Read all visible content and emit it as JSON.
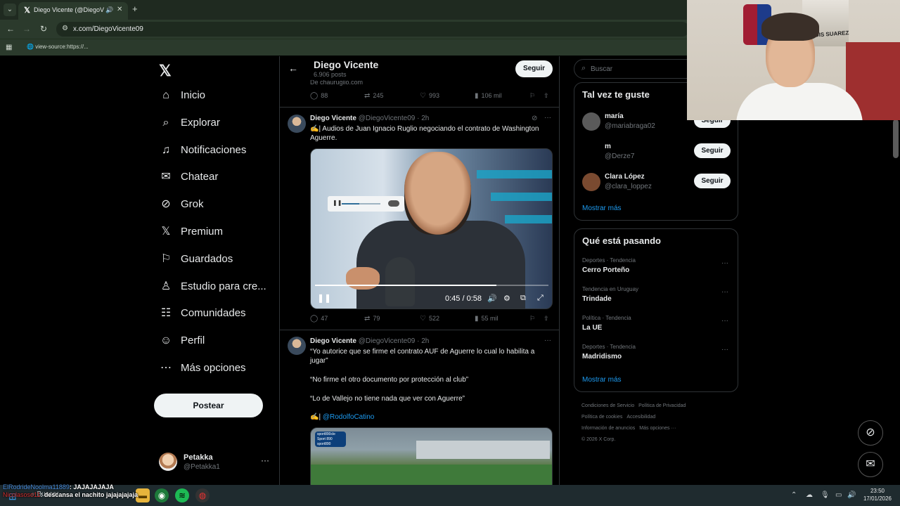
{
  "browser": {
    "tab_title": "Diego Vicente (@DiegoVicente09)",
    "url": "x.com/DiegoVicente09",
    "bookmark": "view-source:https://..."
  },
  "nav": {
    "items": [
      {
        "label": "Inicio",
        "icon": "home-icon",
        "glyph": "⌂"
      },
      {
        "label": "Explorar",
        "icon": "search-icon",
        "glyph": "⌕"
      },
      {
        "label": "Notificaciones",
        "icon": "bell-icon",
        "glyph": "♫"
      },
      {
        "label": "Chatear",
        "icon": "envelope-icon",
        "glyph": "✉"
      },
      {
        "label": "Grok",
        "icon": "grok-icon",
        "glyph": "⊘"
      },
      {
        "label": "Premium",
        "icon": "x-logo-icon",
        "glyph": "𝕏"
      },
      {
        "label": "Guardados",
        "icon": "bookmark-icon",
        "glyph": "⚐"
      },
      {
        "label": "Estudio para cre...",
        "icon": "studio-icon",
        "glyph": "♙"
      },
      {
        "label": "Comunidades",
        "icon": "communities-icon",
        "glyph": "☷"
      },
      {
        "label": "Perfil",
        "icon": "person-icon",
        "glyph": "☺"
      },
      {
        "label": "Más opciones",
        "icon": "more-circle-icon",
        "glyph": "⋯"
      }
    ],
    "post_button": "Postear",
    "account": {
      "name": "Petakka",
      "handle": "@Petakka1"
    }
  },
  "profile": {
    "name": "Diego Vicente",
    "posts": "6.906 posts",
    "follow_label": "Seguir",
    "source_text": "De chaurugiio.com"
  },
  "top_actions": {
    "replies": "88",
    "reposts": "245",
    "likes": "993",
    "views": "106 mil"
  },
  "tweets": [
    {
      "name": "Diego Vicente",
      "handle_time": "@DiegoVicente09 · 2h",
      "text": "✍️| Audios de Juan Ignacio Ruglio negociando el contrato de Washington Aguerre.",
      "video": {
        "time": "0:45 / 0:58",
        "progress": 0.776
      },
      "actions": {
        "replies": "47",
        "reposts": "79",
        "likes": "522",
        "views": "55 mil"
      }
    },
    {
      "name": "Diego Vicente",
      "handle_time": "@DiegoVicente09 · 2h",
      "lines": [
        "“Yo autorice que se firme el contrato AUF  de Aguerre lo cual lo habilita a jugar”",
        "“No firme el otro documento por protección al club”",
        "“Lo de Vallejo no tiene nada que ver con Aguerre”"
      ],
      "mention_prefix": "✍️|",
      "mention": "@RodolfoCatino",
      "badge_text": "sport890cle Sport 890 sport890"
    }
  ],
  "right": {
    "search_placeholder": "Buscar",
    "who_title": "Tal vez te guste",
    "who": [
      {
        "name": "maría",
        "handle": "@mariabraga02",
        "follow": "Seguir",
        "color": "#5a5a5a"
      },
      {
        "name": "m",
        "handle": "@Derze7",
        "follow": "Seguir",
        "color": "#000000"
      },
      {
        "name": "Clara López",
        "handle": "@clara_loppez",
        "follow": "Seguir",
        "color": "#7a4a30"
      }
    ],
    "who_more": "Mostrar más",
    "trends_title": "Qué está pasando",
    "trends": [
      {
        "category": "Deportes · Tendencia",
        "name": "Cerro Porteño"
      },
      {
        "category": "Tendencia en Uruguay",
        "name": "Trindade"
      },
      {
        "category": "Política · Tendencia",
        "name": "La UE"
      },
      {
        "category": "Deportes · Tendencia",
        "name": "Madridismo"
      }
    ],
    "trends_more": "Mostrar más",
    "footer": [
      "Condiciones de Servicio",
      "Política de Privacidad",
      "Política de cookies",
      "Accesibilidad",
      "Información de anuncios",
      "Más opciones ···",
      "© 2026 X Corp."
    ]
  },
  "webcam": {
    "poster_text": "LUIS SUAREZ"
  },
  "taskbar": {
    "search": "Buscar",
    "time": "23:50",
    "date": "17/01/2026"
  },
  "chat": [
    {
      "user": "ElRodrideNoolma11889",
      "message": ": JAJAJAJAJA"
    },
    {
      "user": "Nicolasoso11",
      "message": ": descansa el nachito jajajajajaja"
    }
  ]
}
